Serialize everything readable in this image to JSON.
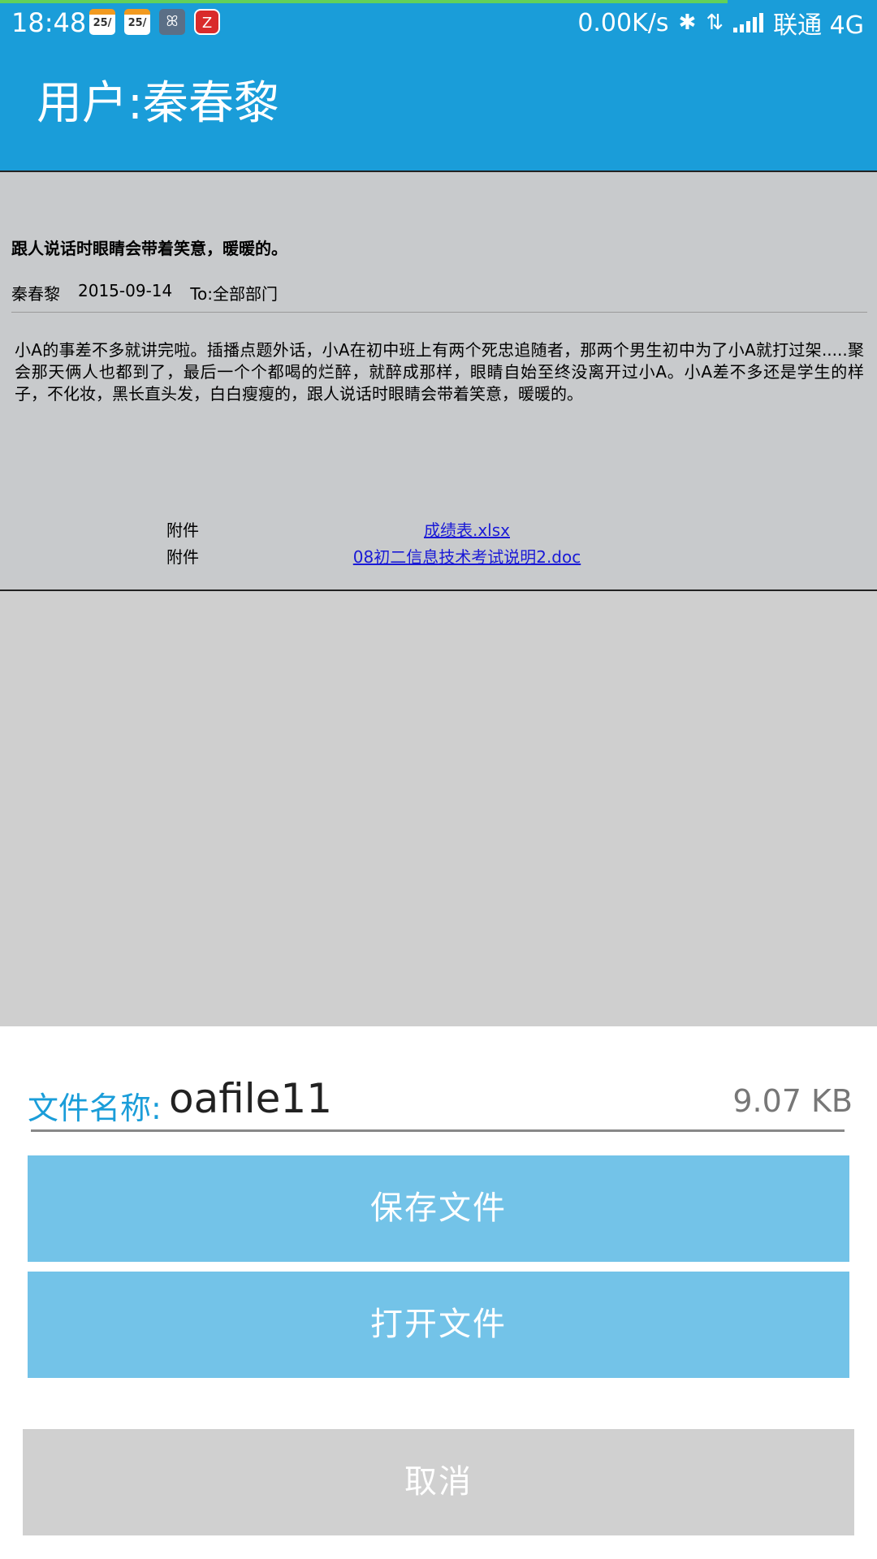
{
  "status_bar": {
    "time": "18:48",
    "calendar_badge_1": "25/",
    "calendar_badge_2": "25/",
    "app_badge": "ꕤ",
    "zhi_badge": "Z",
    "network_speed": "0.00K/s",
    "carrier": "联通 4G",
    "page_load_progress": 0.83,
    "progress_color": "#62d05a"
  },
  "app_bar": {
    "title": "用户:秦春黎",
    "color": "#1a9dd9"
  },
  "post": {
    "title": "跟人说话时眼睛会带着笑意，暖暖的。",
    "author": "秦春黎",
    "date": "2015-09-14",
    "to": "To:全部部门",
    "body": "小A的事差不多就讲完啦。插播点题外话，小A在初中班上有两个死忠追随者，那两个男生初中为了小A就打过架.....聚会那天俩人也都到了，最后一个个都喝的烂醉，就醉成那样，眼睛自始至终没离开过小A。小A差不多还是学生的样子，不化妆，黑长直头发，白白瘦瘦的，跟人说话时眼睛会带着笑意，暖暖的。",
    "attachments": [
      {
        "label": "附件",
        "name": "成绩表.xlsx"
      },
      {
        "label": "附件",
        "name": "08初二信息技术考试说明2.doc"
      }
    ]
  },
  "sheet": {
    "file_label": "文件名称:",
    "file_name": "oafile11",
    "file_size": "9.07 KB",
    "save_label": "保存文件",
    "open_label": "打开文件",
    "cancel_label": "取消",
    "button_color": "#73c3e8",
    "cancel_color": "#d0d0d0"
  }
}
